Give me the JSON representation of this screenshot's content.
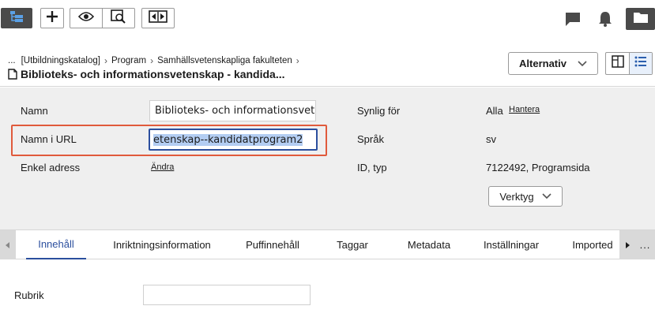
{
  "toolbar": {
    "buttons": [
      {
        "name": "tree-view-button",
        "icon": "tree-icon",
        "active": true
      },
      {
        "name": "add-button",
        "icon": "plus-icon"
      },
      {
        "name": "preview-button",
        "icon": "eye-icon"
      },
      {
        "name": "search-preview-button",
        "icon": "magnifier-page-icon"
      },
      {
        "name": "compare-button",
        "icon": "arrows-icon"
      }
    ],
    "right_icons": [
      "comment-icon",
      "bell-icon",
      "folder-icon"
    ]
  },
  "header": {
    "breadcrumb": [
      "...",
      "[Utbildningskatalog]",
      "Program",
      "Samhällsvetenskapliga fakulteten"
    ],
    "title": "Biblioteks- och informationsvetenskap - kandida...",
    "alternatives_label": "Alternativ"
  },
  "properties": {
    "name_label": "Namn",
    "name_value": "Biblioteks- och informationsvetenskap - kandidatprogram",
    "url_label": "Namn i URL",
    "url_value": "etenskap--kandidatprogram2",
    "simple_address_label": "Enkel adress",
    "simple_address_link": "Ändra",
    "visible_for_label": "Synlig för",
    "visible_for_value": "Alla",
    "manage_link": "Hantera",
    "language_label": "Språk",
    "language_value": "sv",
    "id_type_label": "ID, typ",
    "id_type_value": "7122492, Programsida",
    "tools_label": "Verktyg"
  },
  "tabs": {
    "items": [
      "Innehåll",
      "Inriktningsinformation",
      "Puffinnehåll",
      "Taggar",
      "Metadata",
      "Inställningar",
      "Imported"
    ],
    "active": 0,
    "more_label": "..."
  },
  "content": {
    "rubrik_label": "Rubrik",
    "rubrik_value": ""
  },
  "colors": {
    "accent": "#2b4f9e",
    "highlight": "#e05a3c",
    "panel": "#efefef",
    "dark_button": "#4a4a4a"
  }
}
